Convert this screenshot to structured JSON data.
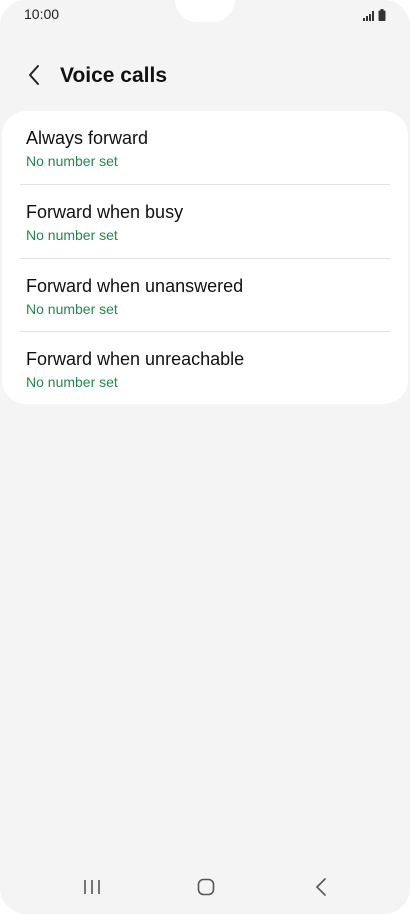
{
  "status_bar": {
    "time": "10:00",
    "icons": [
      "signal-icon",
      "battery-icon"
    ]
  },
  "header": {
    "back_icon": "chevron-left-icon",
    "title": "Voice calls"
  },
  "forwarding_options": [
    {
      "title": "Always forward",
      "subtitle": "No number set"
    },
    {
      "title": "Forward when busy",
      "subtitle": "No number set"
    },
    {
      "title": "Forward when unanswered",
      "subtitle": "No number set"
    },
    {
      "title": "Forward when unreachable",
      "subtitle": "No number set"
    }
  ],
  "nav_bar": {
    "icons": [
      "recents-icon",
      "home-icon",
      "back-icon"
    ]
  },
  "colors": {
    "background": "#f4f4f4",
    "card": "#ffffff",
    "subtitle": "#1f8a4c",
    "text": "#111111"
  }
}
